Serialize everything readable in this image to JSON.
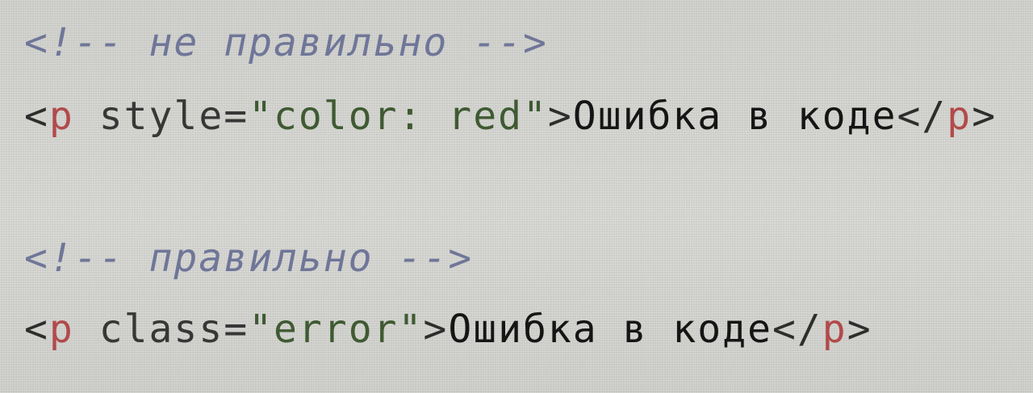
{
  "code_lines": [
    {
      "comment": "<!-- не правильно -->"
    },
    {
      "open_bracket": "<",
      "tag": "p",
      "space": " ",
      "attr_name": "style=",
      "attr_value": "\"color: red\"",
      "close_bracket": ">",
      "text": "Ошибка в коде",
      "end_open": "</",
      "end_tag": "p",
      "end_close": ">"
    },
    {
      "comment": "<!-- правильно -->"
    },
    {
      "open_bracket": "<",
      "tag": "p",
      "space": " ",
      "attr_name": "class=",
      "attr_value": "\"error\"",
      "close_bracket": ">",
      "text": "Ошибка в коде",
      "end_open": "</",
      "end_tag": "p",
      "end_close": ">"
    }
  ],
  "colors": {
    "background": "#d6d7d3",
    "comment": "#6f7698",
    "tag_name": "#b24a4a",
    "attribute_value": "#3f5a32",
    "text": "#151515"
  }
}
